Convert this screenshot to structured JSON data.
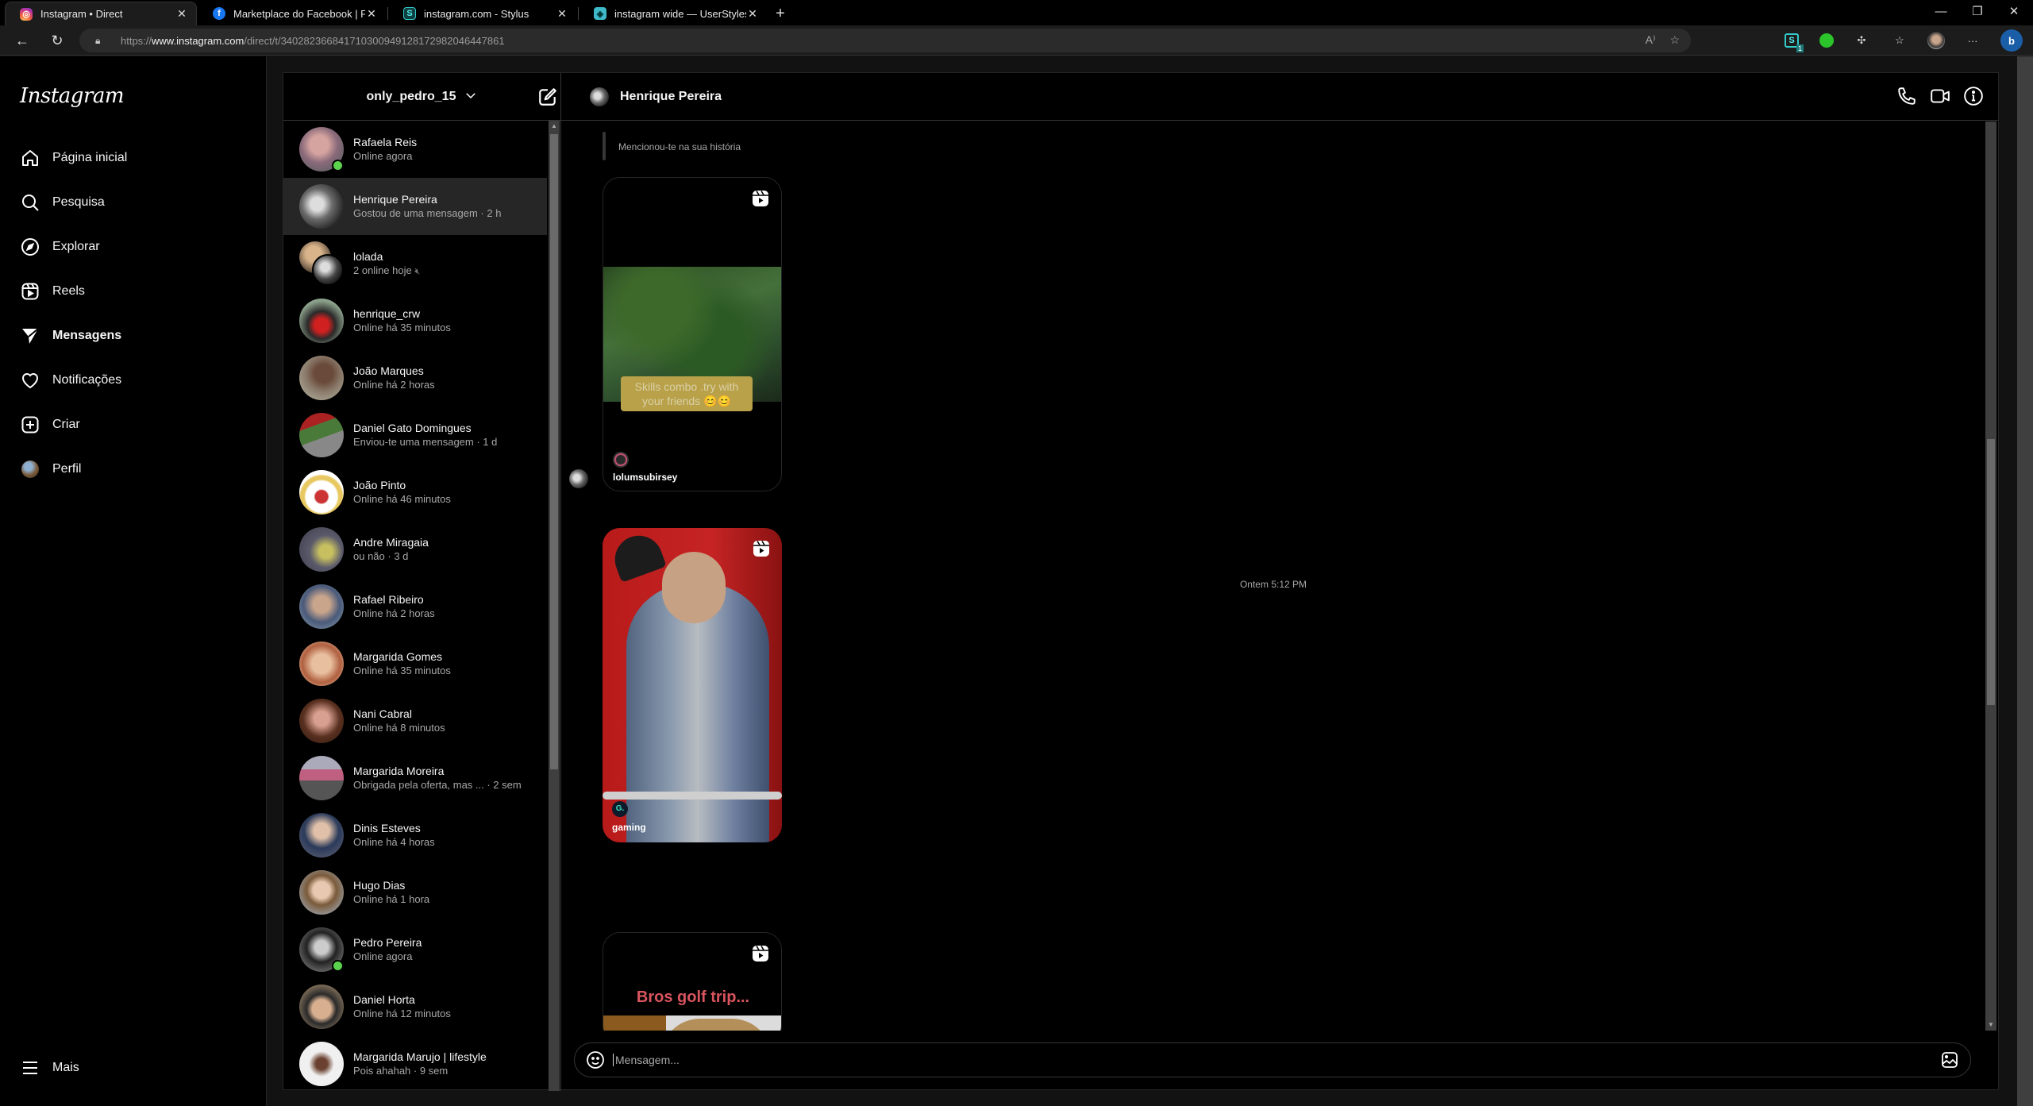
{
  "browser": {
    "tabs": [
      {
        "title": "Instagram • Direct",
        "icon": "instagram-icon",
        "active": true
      },
      {
        "title": "Marketplace do Facebook | Facebook",
        "icon": "facebook-icon",
        "active": false
      },
      {
        "title": "instagram.com - Stylus",
        "icon": "stylus-icon",
        "active": false
      },
      {
        "title": "instagram wide — UserStyles.world",
        "icon": "userstyles-icon",
        "active": false
      }
    ],
    "url": {
      "scheme": "https://",
      "host": "www.instagram.com",
      "path": "/direct/t/340282366841710300949128172982046447861"
    },
    "extension_badge": "1"
  },
  "sidebar": {
    "logo": "Instagram",
    "items": [
      {
        "label": "Página inicial",
        "icon": "home-icon"
      },
      {
        "label": "Pesquisa",
        "icon": "search-icon"
      },
      {
        "label": "Explorar",
        "icon": "compass-icon"
      },
      {
        "label": "Reels",
        "icon": "reels-icon"
      },
      {
        "label": "Mensagens",
        "icon": "messages-icon",
        "active": true
      },
      {
        "label": "Notificações",
        "icon": "heart-icon"
      },
      {
        "label": "Criar",
        "icon": "create-icon"
      },
      {
        "label": "Perfil",
        "icon": "profile-avatar"
      }
    ],
    "more": {
      "label": "Mais",
      "icon": "menu-icon"
    }
  },
  "inbox": {
    "account": "only_pedro_15",
    "conversations": [
      {
        "name": "Rafaela Reis",
        "subtitle": "Online agora",
        "online": true
      },
      {
        "name": "Henrique Pereira",
        "subtitle": "Gostou de uma mensagem · 2 h",
        "selected": true
      },
      {
        "name": "lolada",
        "subtitle": "2 online hoje",
        "muted": true,
        "group": true
      },
      {
        "name": "henrique_crw",
        "subtitle": "Online há 35 minutos"
      },
      {
        "name": "João Marques",
        "subtitle": "Online há 2 horas"
      },
      {
        "name": "Daniel Gato Domingues",
        "subtitle": "Enviou-te uma mensagem · 1 d"
      },
      {
        "name": "João Pinto",
        "subtitle": "Online há 46 minutos"
      },
      {
        "name": "Andre Miragaia",
        "subtitle": "ou não · 3 d"
      },
      {
        "name": "Rafael Ribeiro",
        "subtitle": "Online há 2 horas"
      },
      {
        "name": "Margarida Gomes",
        "subtitle": "Online há 35 minutos"
      },
      {
        "name": "Nani Cabral",
        "subtitle": "Online há 8 minutos"
      },
      {
        "name": "Margarida Moreira",
        "subtitle": "Obrigada pela oferta, mas ... · 2 sem"
      },
      {
        "name": "Dinis Esteves",
        "subtitle": "Online há 4 horas"
      },
      {
        "name": "Hugo Dias",
        "subtitle": "Online há 1 hora"
      },
      {
        "name": "Pedro Pereira",
        "subtitle": "Online agora",
        "online": true
      },
      {
        "name": "Daniel Horta",
        "subtitle": "Online há 12 minutos"
      },
      {
        "name": "Margarida Marujo | lifestyle",
        "subtitle": "Pois ahahah · 9 sem"
      }
    ]
  },
  "chat": {
    "contact": "Henrique Pereira",
    "actions": [
      "phone-icon",
      "video-call-icon",
      "info-icon"
    ],
    "messages": {
      "story_reply_label": "Mencionou-te na sua história",
      "reel1": {
        "caption": "Skills combo .try with your friends 😊😊",
        "owner": "lolumsubirsey"
      },
      "timestamp": "Ontem 5:12 PM",
      "reel2": {
        "owner": "gaming",
        "owner_initial": "G."
      },
      "reel3": {
        "caption": "Bros golf trip..."
      },
      "more_label": "···"
    },
    "composer": {
      "placeholder": "Mensagem..."
    }
  },
  "colors": {
    "online_dot": "#5bd34d",
    "background": "#000000",
    "selected_row": "#262626",
    "secondary_text": "#a8a8a8"
  }
}
